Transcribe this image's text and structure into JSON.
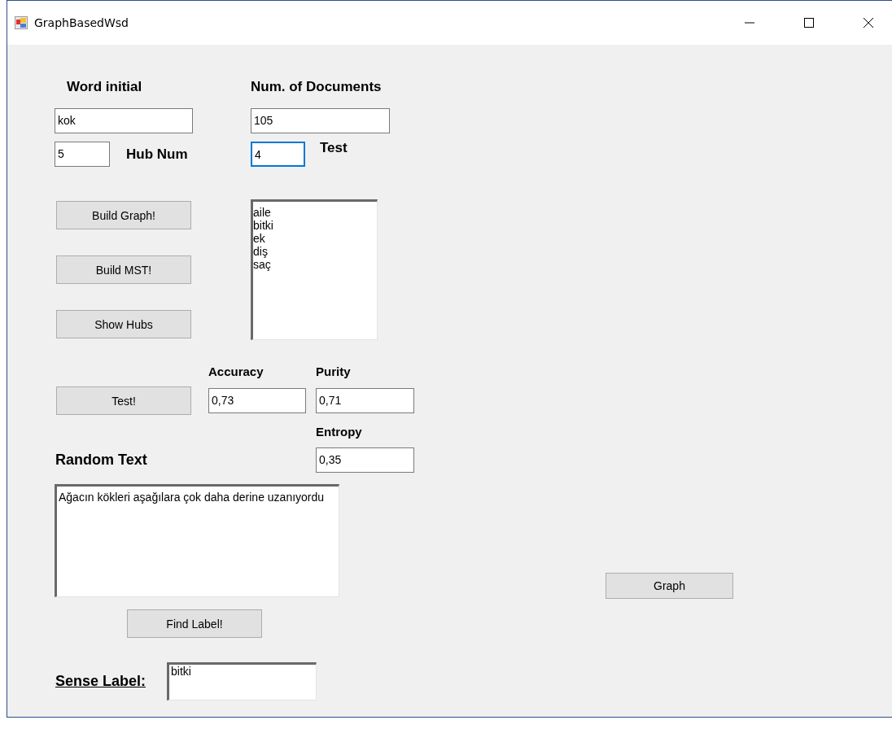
{
  "window": {
    "title": "GraphBasedWsd"
  },
  "word_initial": {
    "label": "Word initial",
    "value": "kok",
    "focused": false
  },
  "num_documents": {
    "label": "Num. of Documents",
    "value": "105",
    "focused": false
  },
  "hub_num": {
    "label": "Hub Num",
    "value": "5",
    "focused": false
  },
  "test_field": {
    "label": "Test",
    "value": "4",
    "focused": true
  },
  "buttons": [
    "Build Graph!",
    "Build MST!",
    "Show Hubs"
  ],
  "hubs_list": [
    "aile",
    "bitki",
    "ek",
    "diş",
    "saç"
  ],
  "test_button": "Test!",
  "accuracy": {
    "label": "Accuracy",
    "value": "0,73"
  },
  "purity": {
    "label": "Purity",
    "value": "0,71"
  },
  "entropy": {
    "label": "Entropy",
    "value": "0,35"
  },
  "random_text": {
    "label": "Random Text",
    "value": "Ağacın kökleri aşağılara çok daha derine uzanıyordu"
  },
  "find_label_button": "Find Label!",
  "graph_button": "Graph",
  "sense_label": {
    "label": "Sense Label:",
    "value": "bitki"
  }
}
